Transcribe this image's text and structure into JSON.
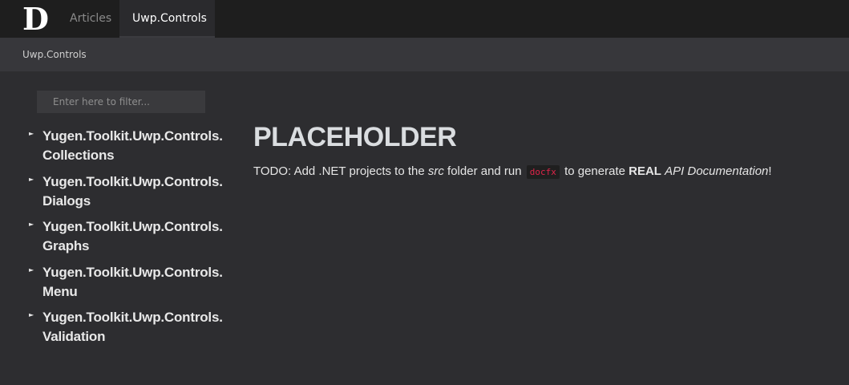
{
  "header": {
    "logo_letter": "D",
    "tabs": [
      {
        "label": "Articles",
        "active": false
      },
      {
        "label": "Uwp.Controls",
        "active": true
      }
    ]
  },
  "breadcrumb": "Uwp.Controls",
  "filter": {
    "placeholder": "Enter here to filter...",
    "value": ""
  },
  "toc": {
    "caret_icon": "triangle-right-icon",
    "items": [
      {
        "line1": "Yugen.Toolkit.Uwp.Controls.",
        "line2": "Collections"
      },
      {
        "line1": "Yugen.Toolkit.Uwp.Controls.",
        "line2": "Dialogs"
      },
      {
        "line1": "Yugen.Toolkit.Uwp.Controls.",
        "line2": "Graphs"
      },
      {
        "line1": "Yugen.Toolkit.Uwp.Controls.",
        "line2": "Menu"
      },
      {
        "line1": "Yugen.Toolkit.Uwp.Controls.",
        "line2": "Validation"
      }
    ]
  },
  "main": {
    "heading": "PLACEHOLDER",
    "text_1": "TODO: Add .NET projects to the ",
    "text_src": "src",
    "text_2": " folder and run ",
    "code": "docfx",
    "text_3": " to generate ",
    "text_real": "REAL",
    "text_4": " ",
    "text_api": "API Documentation",
    "text_5": "!"
  },
  "colors": {
    "topbar_bg": "#1e1e1e",
    "subbar_bg": "#37373b",
    "page_bg": "#2d2d30",
    "code_text": "#e0244a"
  }
}
